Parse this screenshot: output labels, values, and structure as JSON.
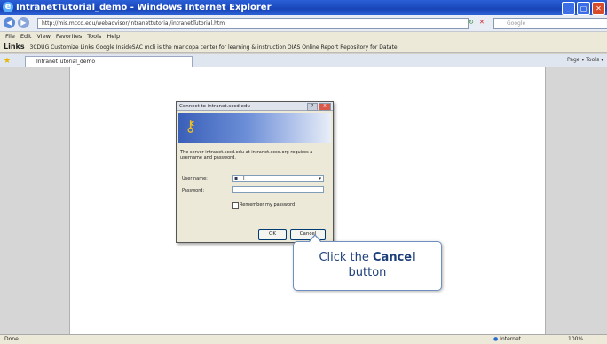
{
  "window": {
    "title": "IntranetTutorial_demo - Windows Internet Explorer",
    "min": "_",
    "max": "▢",
    "close": "✕"
  },
  "address": {
    "url": "http://mis.mccd.edu/webadvisor/intranettutorial/intranetTutorial.htm",
    "search_placeholder": "Google"
  },
  "menu": [
    "File",
    "Edit",
    "View",
    "Favorites",
    "Tools",
    "Help"
  ],
  "links": {
    "label": "Links",
    "text": "3CDUG   Customize Links   Google   InsideSAC   mcli is the maricopa center for learning & instruction   OIAS   Online Report Repository for Datatel"
  },
  "tab": {
    "label": "IntranetTutorial_demo"
  },
  "tools_text": "Page ▾   Tools ▾",
  "dialog": {
    "title": "Connect to intranet.sccd.edu",
    "help": "?",
    "close": "X",
    "message": "The server intranet.sccd.edu at intranet.sccd.org requires a username and password.",
    "username_label": "User name:",
    "username_value": "I",
    "password_label": "Password:",
    "remember_label": "Remember my password",
    "ok_label": "OK",
    "cancel_label": "Cancel"
  },
  "callout": {
    "line1_pre": "Click the ",
    "line1_bold": "Cancel",
    "line2": "button"
  },
  "status": {
    "left": "Done",
    "zone": "Internet",
    "zoom": "100%"
  }
}
